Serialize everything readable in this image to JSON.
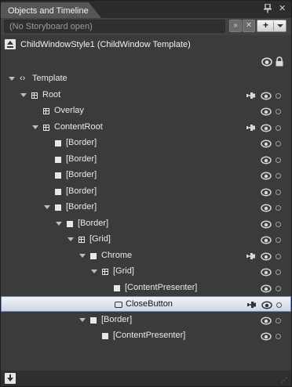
{
  "panel": {
    "title": "Objects and Timeline"
  },
  "storyboard": {
    "placeholder": "(No Storyboard open)"
  },
  "scope": {
    "label": "ChildWindowStyle1 (ChildWindow Template)"
  },
  "tree": [
    {
      "label": "Template",
      "icon": "template-icon",
      "expander": true,
      "pin": false,
      "eye": false,
      "lock": false,
      "selected": false
    },
    {
      "label": "Root",
      "icon": "grid-icon",
      "expander": true,
      "pin": true,
      "eye": true,
      "lock": true,
      "selected": false
    },
    {
      "label": "Overlay",
      "icon": "grid-icon",
      "expander": false,
      "pin": false,
      "eye": true,
      "lock": true,
      "selected": false
    },
    {
      "label": "ContentRoot",
      "icon": "grid-icon",
      "expander": true,
      "pin": true,
      "eye": true,
      "lock": true,
      "selected": false
    },
    {
      "label": "[Border]",
      "icon": "border-icon",
      "expander": false,
      "pin": false,
      "eye": true,
      "lock": true,
      "selected": false
    },
    {
      "label": "[Border]",
      "icon": "border-icon",
      "expander": false,
      "pin": false,
      "eye": true,
      "lock": true,
      "selected": false
    },
    {
      "label": "[Border]",
      "icon": "border-icon",
      "expander": false,
      "pin": false,
      "eye": true,
      "lock": true,
      "selected": false
    },
    {
      "label": "[Border]",
      "icon": "border-icon",
      "expander": false,
      "pin": false,
      "eye": true,
      "lock": true,
      "selected": false
    },
    {
      "label": "[Border]",
      "icon": "border-icon",
      "expander": true,
      "pin": false,
      "eye": true,
      "lock": true,
      "selected": false
    },
    {
      "label": "[Border]",
      "icon": "border-icon",
      "expander": true,
      "pin": false,
      "eye": true,
      "lock": true,
      "selected": false
    },
    {
      "label": "[Grid]",
      "icon": "grid-icon",
      "expander": true,
      "pin": false,
      "eye": true,
      "lock": true,
      "selected": false
    },
    {
      "label": "Chrome",
      "icon": "border-icon",
      "expander": true,
      "pin": true,
      "eye": true,
      "lock": true,
      "selected": false
    },
    {
      "label": "[Grid]",
      "icon": "grid-icon",
      "expander": true,
      "pin": false,
      "eye": true,
      "lock": true,
      "selected": false
    },
    {
      "label": "[ContentPresenter]",
      "icon": "border-icon",
      "expander": false,
      "pin": false,
      "eye": true,
      "lock": true,
      "selected": false
    },
    {
      "label": "CloseButton",
      "icon": "button-icon",
      "expander": false,
      "pin": true,
      "eye": true,
      "lock": true,
      "selected": true
    },
    {
      "label": "[Border]",
      "icon": "border-icon",
      "expander": true,
      "pin": false,
      "eye": true,
      "lock": true,
      "selected": false
    },
    {
      "label": "[ContentPresenter]",
      "icon": "border-icon",
      "expander": false,
      "pin": false,
      "eye": true,
      "lock": true,
      "selected": false
    }
  ]
}
